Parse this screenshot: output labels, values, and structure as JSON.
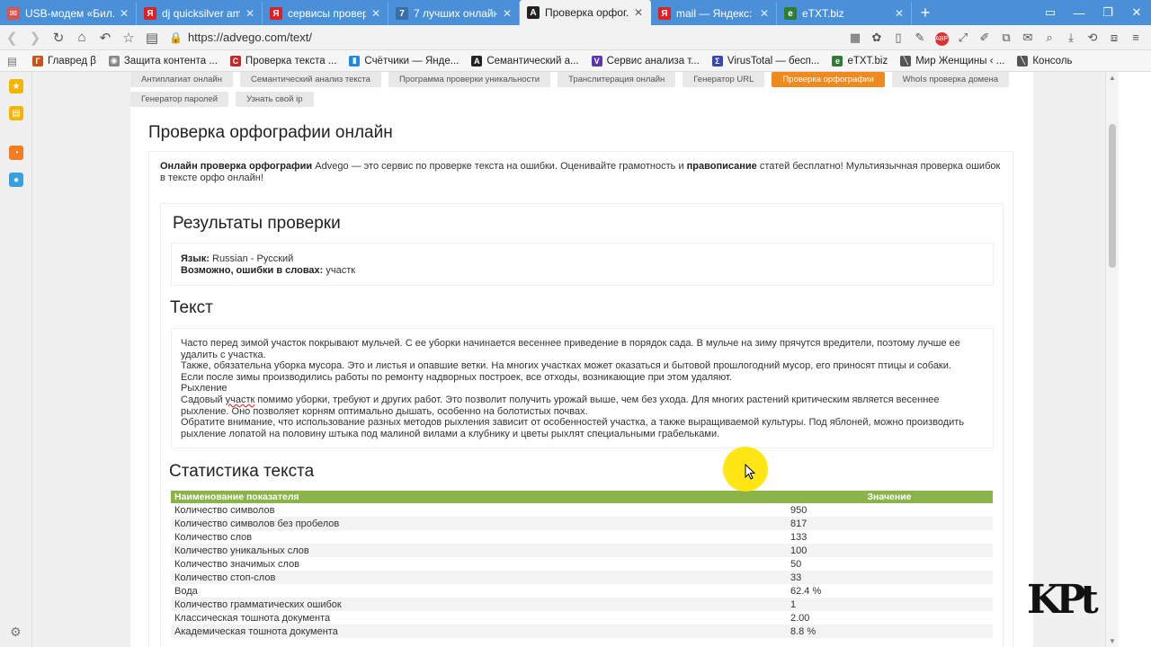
{
  "tabs": [
    {
      "title": "USB-модем «Бил...",
      "icon_color": "#d9534f",
      "icon_text": "✉",
      "active": false
    },
    {
      "title": "dj quicksilver ame...",
      "icon_color": "#e02020",
      "icon_text": "Я",
      "active": false
    },
    {
      "title": "сервисы провер...",
      "icon_color": "#e02020",
      "icon_text": "Я",
      "active": false
    },
    {
      "title": "7 лучших онлайн...",
      "icon_color": "#3b6ea8",
      "icon_text": "7",
      "active": false
    },
    {
      "title": "Проверка орфог...",
      "icon_color": "#222222",
      "icon_text": "A",
      "active": true
    },
    {
      "title": "mail — Яндекс: н...",
      "icon_color": "#e02020",
      "icon_text": "Я",
      "active": false
    },
    {
      "title": "eTXT.biz",
      "icon_color": "#2e7d32",
      "icon_text": "e",
      "active": false
    }
  ],
  "address": {
    "url": "https://advego.com/text/"
  },
  "bookmarks": [
    {
      "label": "Главред β",
      "color": "#c9541a",
      "icon": "Г"
    },
    {
      "label": "Защита контента ...",
      "color": "#888888",
      "icon": "◉"
    },
    {
      "label": "Проверка текста ...",
      "color": "#c62828",
      "icon": "C"
    },
    {
      "label": "Счётчики — Янде...",
      "color": "#1e88e5",
      "icon": "▮"
    },
    {
      "label": "Семантический а...",
      "color": "#222222",
      "icon": "A"
    },
    {
      "label": "Сервис анализа т...",
      "color": "#5e35b1",
      "icon": "V"
    },
    {
      "label": "VirusTotal — бесп...",
      "color": "#3949ab",
      "icon": "Σ"
    },
    {
      "label": "eTXT.biz",
      "color": "#2e7d32",
      "icon": "e"
    },
    {
      "label": "Мир Женщины ‹ ...",
      "color": "#555555",
      "icon": "╲"
    },
    {
      "label": "Консоль",
      "color": "#555555",
      "icon": "╲"
    }
  ],
  "tools": {
    "row1": [
      "Антиплагиат онлайн",
      "Семантический анализ текста",
      "Программа проверки уникальности",
      "Транслитерация онлайн",
      "Генератор URL",
      "Проверка орфографии",
      "WhoIs проверка домена"
    ],
    "row2": [
      "Генератор паролей",
      "Узнать свой ip"
    ],
    "active": "Проверка орфографии"
  },
  "page": {
    "title": "Проверка орфографии онлайн",
    "intro_bold1": "Онлайн проверка орфографии",
    "intro_text1": " Advego — это сервис по проверке текста на ошибки. Оценивайте грамотность и ",
    "intro_bold2": "правописание",
    "intro_text2": " статей бесплатно! Мультиязычная проверка ошибок в тексте орфо онлайн!"
  },
  "results": {
    "title": "Результаты проверки",
    "lang_label": "Язык:",
    "lang_value": "Russian - Русский",
    "errors_label": "Возможно, ошибки в словах:",
    "errors_value": "участк"
  },
  "text_section": {
    "title": "Текст",
    "line1": "Часто перед зимой участок покрывают мульчей. С ее уборки начинается весеннее приведение в порядок сада. В мульче на зиму прячутся вредители, поэтому лучше ее удалить с участка.",
    "line2": "Также, обязательна уборка мусора. Это и листья и опавшие ветки. На многих участках может оказаться и бытовой прошлогодний мусор, его приносят птицы и собаки.",
    "line3": "Если после зимы производились работы по ремонту надворных построек, все отходы, возникающие при этом удаляют.",
    "line4": "Рыхление",
    "line5_a": "Садовый ",
    "line5_err": "участк",
    "line5_b": " помимо уборки, требуют и других работ. Это позволит получить урожай выше, чем без ухода. Для многих растений критическим является весеннее рыхление. Оно позволяет корням оптимально дышать, особенно на болотистых почвах.",
    "line6": "Обратите внимание, что использование разных методов рыхления зависит от особенностей участка, а также выращиваемой культуры. Под яблоней, можно производить рыхление лопатой на половину штыка под малиной вилами а клубнику и цветы рыхлят специальными грабельками."
  },
  "stats": {
    "title": "Статистика текста",
    "header_name": "Наименование показателя",
    "header_value": "Значение",
    "rows": [
      {
        "name": "Количество символов",
        "value": "950"
      },
      {
        "name": "Количество символов без пробелов",
        "value": "817"
      },
      {
        "name": "Количество слов",
        "value": "133"
      },
      {
        "name": "Количество уникальных слов",
        "value": "100"
      },
      {
        "name": "Количество значимых слов",
        "value": "50"
      },
      {
        "name": "Количество стоп-слов",
        "value": "33"
      },
      {
        "name": "Вода",
        "value": "62.4 %"
      },
      {
        "name": "Количество грамматических ошибок",
        "value": "1"
      },
      {
        "name": "Классическая тошнота документа",
        "value": "2.00"
      },
      {
        "name": "Академическая тошнота документа",
        "value": "8.8 %"
      }
    ]
  },
  "colors": {
    "tab_bar": "#4a90d9",
    "accent_orange": "#f08a1e",
    "table_header": "#8ab34a"
  }
}
